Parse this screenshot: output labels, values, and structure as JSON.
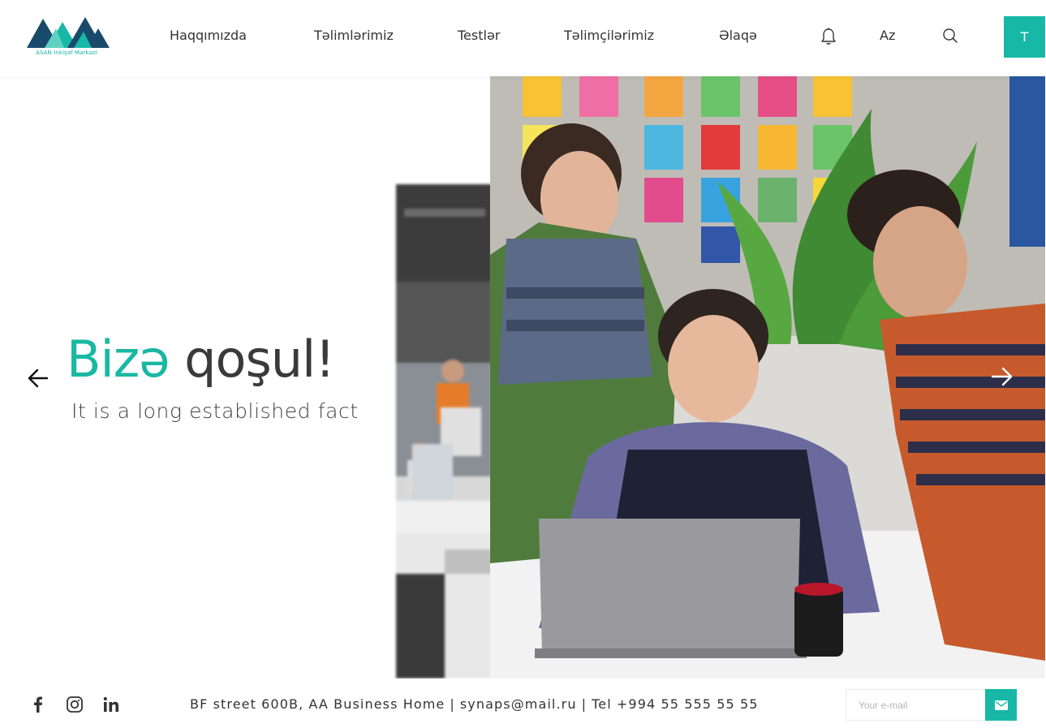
{
  "brand": {
    "logo_text": "ASAN İnkişaf Mərkəzi",
    "accent_color": "#17b8a6",
    "logo_dark_color": "#1a4a6b"
  },
  "nav": {
    "items": [
      {
        "label": "Haqqımızda"
      },
      {
        "label": "Təlimlərimiz"
      },
      {
        "label": "Testlər"
      },
      {
        "label": "Təlimçilərimiz"
      },
      {
        "label": "Əlaqə"
      }
    ],
    "bell_icon": "bell-icon",
    "language": "Az",
    "search_icon": "search-icon",
    "user_initial": "T"
  },
  "hero": {
    "title_accent": "Bizə",
    "title_rest": "qoşul!",
    "subtitle": "It is a long established fact",
    "prev_icon": "arrow-left-icon",
    "next_icon": "arrow-right-icon"
  },
  "footer": {
    "social": [
      "facebook-icon",
      "instagram-icon",
      "linkedin-icon"
    ],
    "address": "BF street 600B, AA Business Home",
    "email": "synaps@mail.ru",
    "phone": "Tel +994 55 555 55 55",
    "subscribe_placeholder": "Your e-mail",
    "send_icon": "mail-icon"
  }
}
